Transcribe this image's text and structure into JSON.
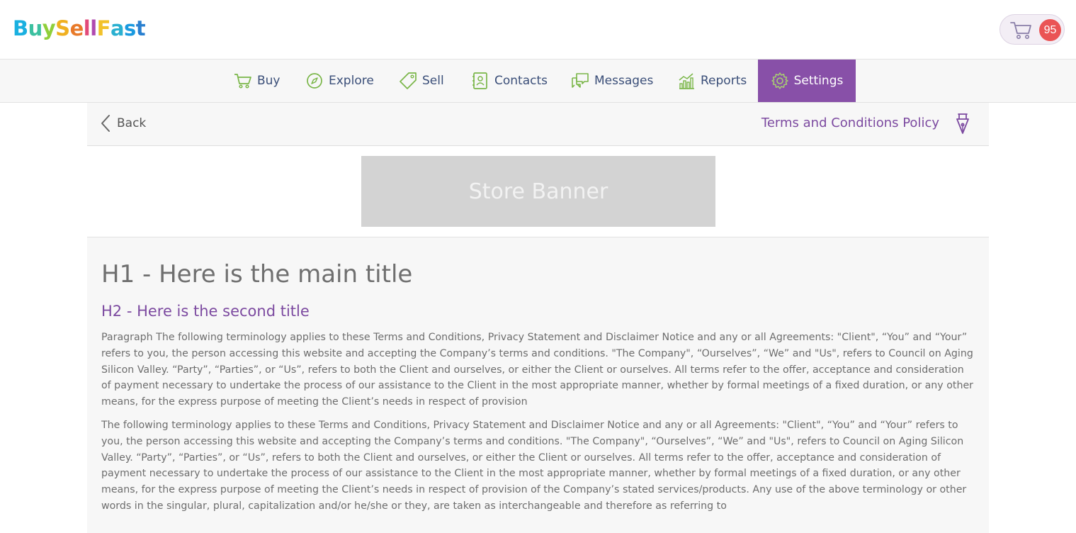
{
  "header": {
    "logo_letters": [
      {
        "ch": "B",
        "color": "#1ab0e0"
      },
      {
        "ch": "u",
        "color": "#3cc0a0"
      },
      {
        "ch": "y",
        "color": "#8fcf3a"
      },
      {
        "ch": "S",
        "color": "#f0b020"
      },
      {
        "ch": "e",
        "color": "#e87a2a"
      },
      {
        "ch": "l",
        "color": "#e24a7a"
      },
      {
        "ch": "l",
        "color": "#b04ab0"
      },
      {
        "ch": "F",
        "color": "#f2c22a"
      },
      {
        "ch": "a",
        "color": "#2ab0d0"
      },
      {
        "ch": "s",
        "color": "#1a9ae0"
      },
      {
        "ch": "t",
        "color": "#2a80d0"
      }
    ],
    "cart_count": "95",
    "cart_icon": "cart-icon"
  },
  "nav": {
    "items": [
      {
        "label": "Buy",
        "icon": "cart-icon"
      },
      {
        "label": "Explore",
        "icon": "compass-icon"
      },
      {
        "label": "Sell",
        "icon": "tag-icon"
      },
      {
        "label": "Contacts",
        "icon": "address-book-icon"
      },
      {
        "label": "Messages",
        "icon": "chat-bubbles-icon"
      },
      {
        "label": "Reports",
        "icon": "bar-chart-icon"
      },
      {
        "label": "Settings",
        "icon": "gear-icon"
      }
    ],
    "active": "Settings"
  },
  "subbar": {
    "back_label": "Back",
    "page_title": "Terms and Conditions Policy"
  },
  "banner": {
    "label": "Store Banner"
  },
  "content": {
    "h1": "H1 - Here is the main title",
    "h2": "H2 - Here is the second title",
    "p1": "Paragraph The following terminology applies to these Terms and Conditions, Privacy Statement and Disclaimer Notice and any or all Agreements: \"Client\", “You” and “Your” refers to you, the person accessing this website and accepting the Company’s terms and conditions. \"The Company\", “Ourselves”, “We” and \"Us\", refers to Council on Aging Silicon Valley. “Party”, “Parties”, or “Us”, refers to both the Client and ourselves, or either the Client or ourselves. All terms refer to the offer, acceptance and consideration of payment necessary to undertake the process of our assistance to the Client in the most appropriate manner, whether by formal meetings of a fixed duration, or any other means, for the express purpose of meeting the Client’s needs in respect of provision",
    "p2": "The following terminology applies to these Terms and Conditions, Privacy Statement and Disclaimer Notice and any or all Agreements: \"Client\", “You” and “Your” refers to you, the person accessing this website and accepting the Company’s terms and conditions. \"The Company\", “Ourselves”, “We” and \"Us\", refers to Council on Aging Silicon Valley. “Party”, “Parties”, or “Us”, refers to both the Client and ourselves, or either the Client or ourselves. All terms refer to the offer, acceptance and consideration of payment necessary to undertake the process of our assistance to the Client in the most appropriate manner, whether by formal meetings of a fixed duration, or any other means, for the express purpose of meeting the Client’s needs in respect of provision of the Company’s stated services/products. Any use of the above terminology or other words in the singular, plural, capitalization and/or he/she or they, are taken as interchangeable and therefore as referring to"
  },
  "colors": {
    "accent": "#8850a8",
    "nav_text": "#3a4e78",
    "icon_green": "#7ab648",
    "badge": "#ea5455"
  }
}
